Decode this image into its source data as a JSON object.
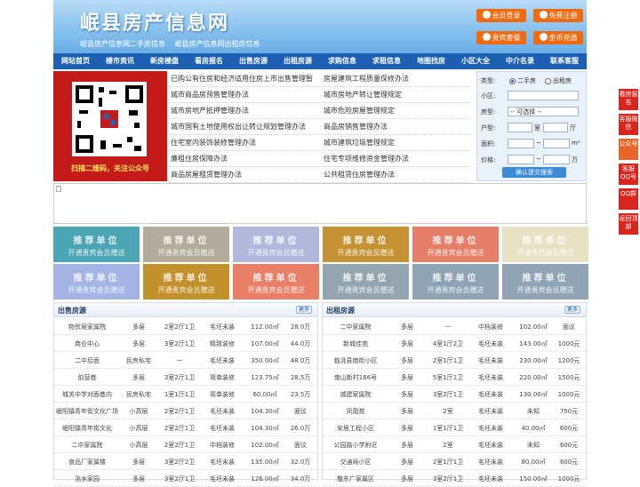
{
  "header": {
    "title": "岷县房产信息网",
    "subtitle_1": "岷县房产信息网二手房信息",
    "subtitle_2": "岷县房产信息网出租房信息",
    "buttons": [
      "会员登录",
      "免费注册",
      "贵宾套餐",
      "金币充值"
    ]
  },
  "nav": [
    "网站首页",
    "楼市资讯",
    "新房楼盘",
    "看房报名",
    "出售房源",
    "出租房源",
    "求购信息",
    "求租信息",
    "地图找房",
    "小区大全",
    "中介名录",
    "联系客服"
  ],
  "qr": {
    "caption": "扫描二维码，关注公众号"
  },
  "links": [
    [
      "已购公有住房和经济适用住房上市出售管理暂",
      "房屋建筑工程质量保修办法"
    ],
    [
      "城市商品房预售管理办法",
      "城市房地产转让管理规定"
    ],
    [
      "城市房地产抵押管理办法",
      "城市危险房屋管理规定"
    ],
    [
      "城市国有土地使用权出让转让规划管理办法",
      "商品房销售管理办法"
    ],
    [
      "住宅室内装饰装修管理办法",
      "城市建筑垃圾管理规定"
    ],
    [
      "廉租住房保障办法",
      "住宅专项维修资金管理办法"
    ],
    [
      "商品房屋租赁管理办法",
      "公共租赁住房管理办法"
    ]
  ],
  "search": {
    "type_label": "类型:",
    "type_options": [
      "二手房",
      "出租房"
    ],
    "area_label": "小区:",
    "house_label": "房型:",
    "house_select": "-- 可选择 --",
    "layout_label": "户型:",
    "room_unit": "室",
    "hall_unit": "厅",
    "size_label": "面积:",
    "size_unit": "m²",
    "price_label": "价格:",
    "price_unit": "万",
    "tilde": "~",
    "submit": "确认提交搜索"
  },
  "tiles": {
    "line1": "推荐单位",
    "line2": "开通贵宾会员赠送"
  },
  "tile_colors": [
    "#4aa6b4",
    "#b1ad9a",
    "#b1b8dc",
    "#c59233",
    "#e77e68",
    "#e6e2c3",
    "#a4b4e4",
    "#c3912b",
    "#ea7f67",
    "#93a6b0",
    "#8ea4b4",
    "#91a4b6"
  ],
  "sale": {
    "title": "出售房源",
    "more": "更多",
    "rows": [
      [
        "物贸局家属院",
        "多层",
        "2室2厅1卫",
        "毛坯未装",
        "112.00㎡",
        "28.0万"
      ],
      [
        "商业中心",
        "多层",
        "3室2厅1卫",
        "精致装修",
        "107.00㎡",
        "44.0万"
      ],
      [
        "二中后面",
        "民房私宅",
        "—",
        "毛坯未装",
        "350.00㎡",
        "48.0万"
      ],
      [
        "前营巷",
        "多层",
        "3室2厅1卫",
        "简单装修",
        "123.75㎡",
        "28.5万"
      ],
      [
        "城关中学对面巷内",
        "民房私宅",
        "1室1厅1卫",
        "简单装修",
        "60.00㎡",
        "23.5万"
      ],
      [
        "岷阳镇青年街文化广场",
        "小高层",
        "2室2厅1卫",
        "毛坯未装",
        "104.30㎡",
        "面议"
      ],
      [
        "岷阳镇青年街文化",
        "小高层",
        "2室2厅1卫",
        "毛坯未装",
        "104.30㎡",
        "26.0万"
      ],
      [
        "二中家属院",
        "小高层",
        "2室2厅1卫",
        "中档装修",
        "102.00㎡",
        "面议"
      ],
      [
        "食品厂家属楼",
        "多层",
        "3室2厅2卫",
        "毛坯未装",
        "135.00㎡",
        "32.0万"
      ],
      [
        "洮水家园",
        "多层",
        "3室2厅1卫",
        "毛坯未装",
        "126.00㎡",
        "34.0万"
      ]
    ]
  },
  "rent": {
    "title": "出租房源",
    "more": "更多",
    "rows": [
      [
        "二中家属院",
        "多层",
        "—",
        "中档装修",
        "102.00㎡",
        "面议"
      ],
      [
        "新城佳苑",
        "多层",
        "4室1厅2卫",
        "毛坯未装",
        "143.00㎡",
        "1000元"
      ],
      [
        "临洮县南街小区",
        "多层",
        "2室1厅1卫",
        "毛坯未装",
        "230.00㎡",
        "1200元"
      ],
      [
        "南山新村166号",
        "多层",
        "5室1厅1卫",
        "毛坯未装",
        "220.00㎡",
        "1500元"
      ],
      [
        "城建家属院",
        "多层",
        "3室2厅1卫",
        "毛坯未装",
        "130.00㎡",
        "1000元"
      ],
      [
        "凤凰苑",
        "多层",
        "2室",
        "毛坯未装",
        "未知",
        "750元"
      ],
      [
        "安居工程小区",
        "多层",
        "1室1厅1卫",
        "毛坯未装",
        "40.00㎡",
        "600元"
      ],
      [
        "公园路小学附近",
        "多层",
        "2室",
        "毛坯未装",
        "未知",
        "600元"
      ],
      [
        "交通局小区",
        "多层",
        "2室1厅1卫",
        "毛坯未装",
        "80.00㎡",
        "600元"
      ],
      [
        "敬东广家属区",
        "多层",
        "3室2厅1卫",
        "毛坯未装",
        "150.00㎡",
        "1000元"
      ]
    ]
  },
  "side": [
    "看房报名",
    "客服微信",
    "公众号",
    "客服QQ号",
    "QQ群",
    "返回顶部"
  ]
}
